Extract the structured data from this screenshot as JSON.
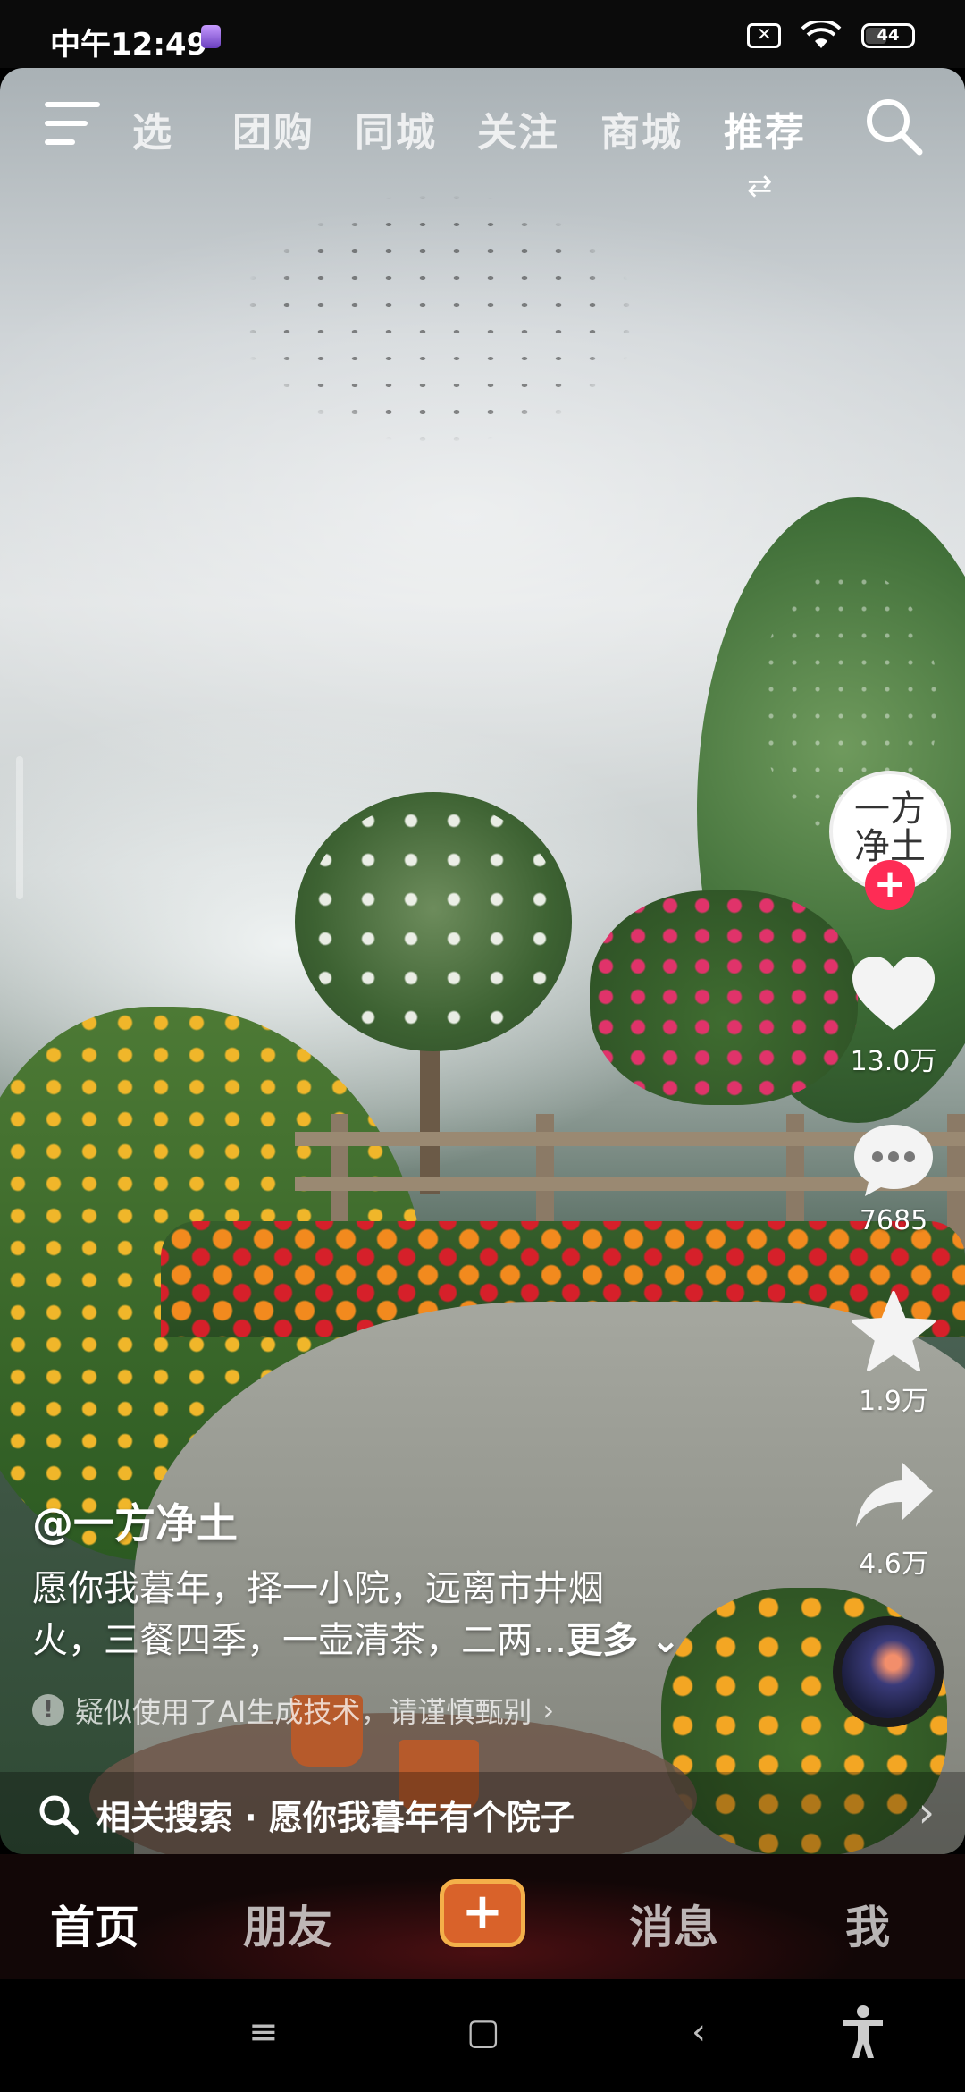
{
  "status_bar": {
    "time": "中午12:49",
    "battery": "44"
  },
  "top_nav": {
    "tabs": [
      {
        "label": "精选",
        "active": false
      },
      {
        "label": "团购",
        "active": false
      },
      {
        "label": "同城",
        "active": false
      },
      {
        "label": "关注",
        "active": false
      },
      {
        "label": "商城",
        "active": false
      },
      {
        "label": "推荐",
        "active": true
      }
    ],
    "visible_first_tab": "选"
  },
  "actions": {
    "avatar_text": "一方净土",
    "likes": "13.0万",
    "comments": "7685",
    "favorites": "1.9万",
    "shares": "4.6万"
  },
  "post": {
    "author": "@一方净土",
    "caption_line1": "愿你我暮年，择一小院，远离市井烟",
    "caption_line2": "火，三餐四季，一壶清茶，二两...",
    "more_label": "更多",
    "ai_notice": "疑似使用了AI生成技术，请谨慎甄别"
  },
  "related_search": {
    "text": "相关搜索 · 愿你我暮年有个院子"
  },
  "bottom_tabs": {
    "home": "首页",
    "friends": "朋友",
    "create": "+",
    "messages": "消息",
    "me": "我"
  },
  "colors": {
    "accent": "#fe2c55",
    "create_button": "#d9622a"
  }
}
